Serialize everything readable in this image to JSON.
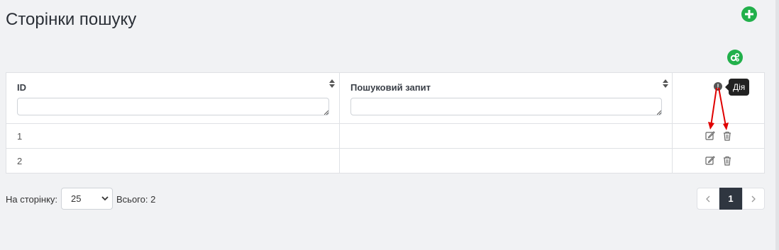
{
  "page": {
    "title": "Сторінки пошуку"
  },
  "toolbar": {
    "add_icon": "plus-circle-icon",
    "settings_icon": "gears-icon",
    "accent": "#22b04b"
  },
  "grid": {
    "columns": [
      {
        "header": "ID",
        "filter_value": ""
      },
      {
        "header": "Пошуковий запит",
        "filter_value": ""
      },
      {
        "header": "",
        "tooltip": "Дія"
      }
    ],
    "rows": [
      {
        "id": "1",
        "query": ""
      },
      {
        "id": "2",
        "query": ""
      }
    ]
  },
  "footer": {
    "per_page_label": "На сторінку:",
    "per_page_value": "25",
    "total_label": "Всього: 2",
    "pages": [
      "1"
    ],
    "current_page": "1"
  }
}
